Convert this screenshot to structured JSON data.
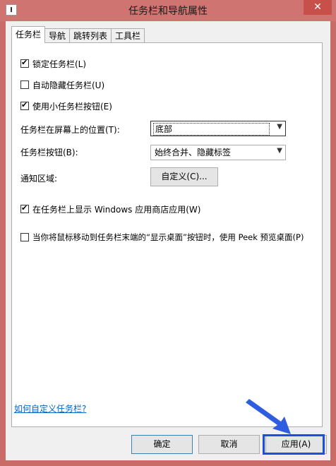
{
  "window": {
    "title": "任务栏和导航属性",
    "close_glyph": "✕"
  },
  "tabs": [
    {
      "label": "任务栏",
      "active": true
    },
    {
      "label": "导航",
      "active": false
    },
    {
      "label": "跳转列表",
      "active": false
    },
    {
      "label": "工具栏",
      "active": false
    }
  ],
  "options": {
    "lock_taskbar": {
      "label": "锁定任务栏(L)",
      "checked": true
    },
    "auto_hide": {
      "label": "自动隐藏任务栏(U)",
      "checked": false
    },
    "small_buttons": {
      "label": "使用小任务栏按钮(E)",
      "checked": true
    },
    "position_label": "任务栏在屏幕上的位置(T):",
    "position_value": "底部",
    "buttons_label": "任务栏按钮(B):",
    "buttons_value": "始终合并、隐藏标签",
    "notify_label": "通知区域:",
    "customize_button": "自定义(C)...",
    "show_store_apps": {
      "label": "在任务栏上显示 Windows 应用商店应用(W)",
      "checked": true
    },
    "peek": {
      "label": "当你将鼠标移动到任务栏末端的“显示桌面”按钮时，使用 Peek 预览桌面(P)",
      "checked": false
    }
  },
  "help_link": "如何自定义任务栏?",
  "footer": {
    "ok": "确定",
    "cancel": "取消",
    "apply": "应用(A)"
  },
  "icons": {
    "checkmark": "✔",
    "dropdown": "▼"
  }
}
